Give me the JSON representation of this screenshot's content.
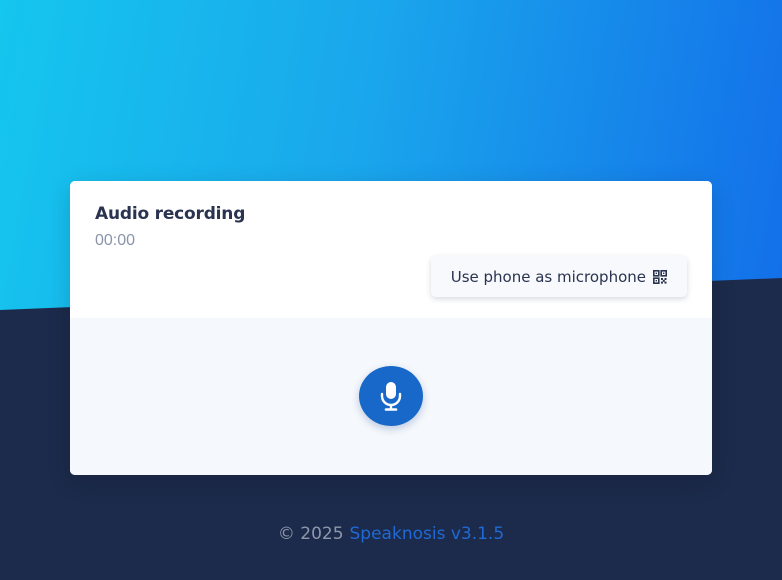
{
  "card": {
    "title": "Audio recording",
    "timer": "00:00",
    "phone_button_label": "Use phone as microphone",
    "phone_button_icon": "qr-code-icon",
    "record_button_icon": "microphone-icon"
  },
  "footer": {
    "copyright": "© 2025",
    "brand_link": "Speaknosis v3.1.5"
  },
  "colors": {
    "background_dark": "#1c2a4b",
    "gradient_start": "#15c6ee",
    "gradient_end": "#136fe9",
    "accent": "#1768c8",
    "brand_link": "#1f6ad6"
  }
}
